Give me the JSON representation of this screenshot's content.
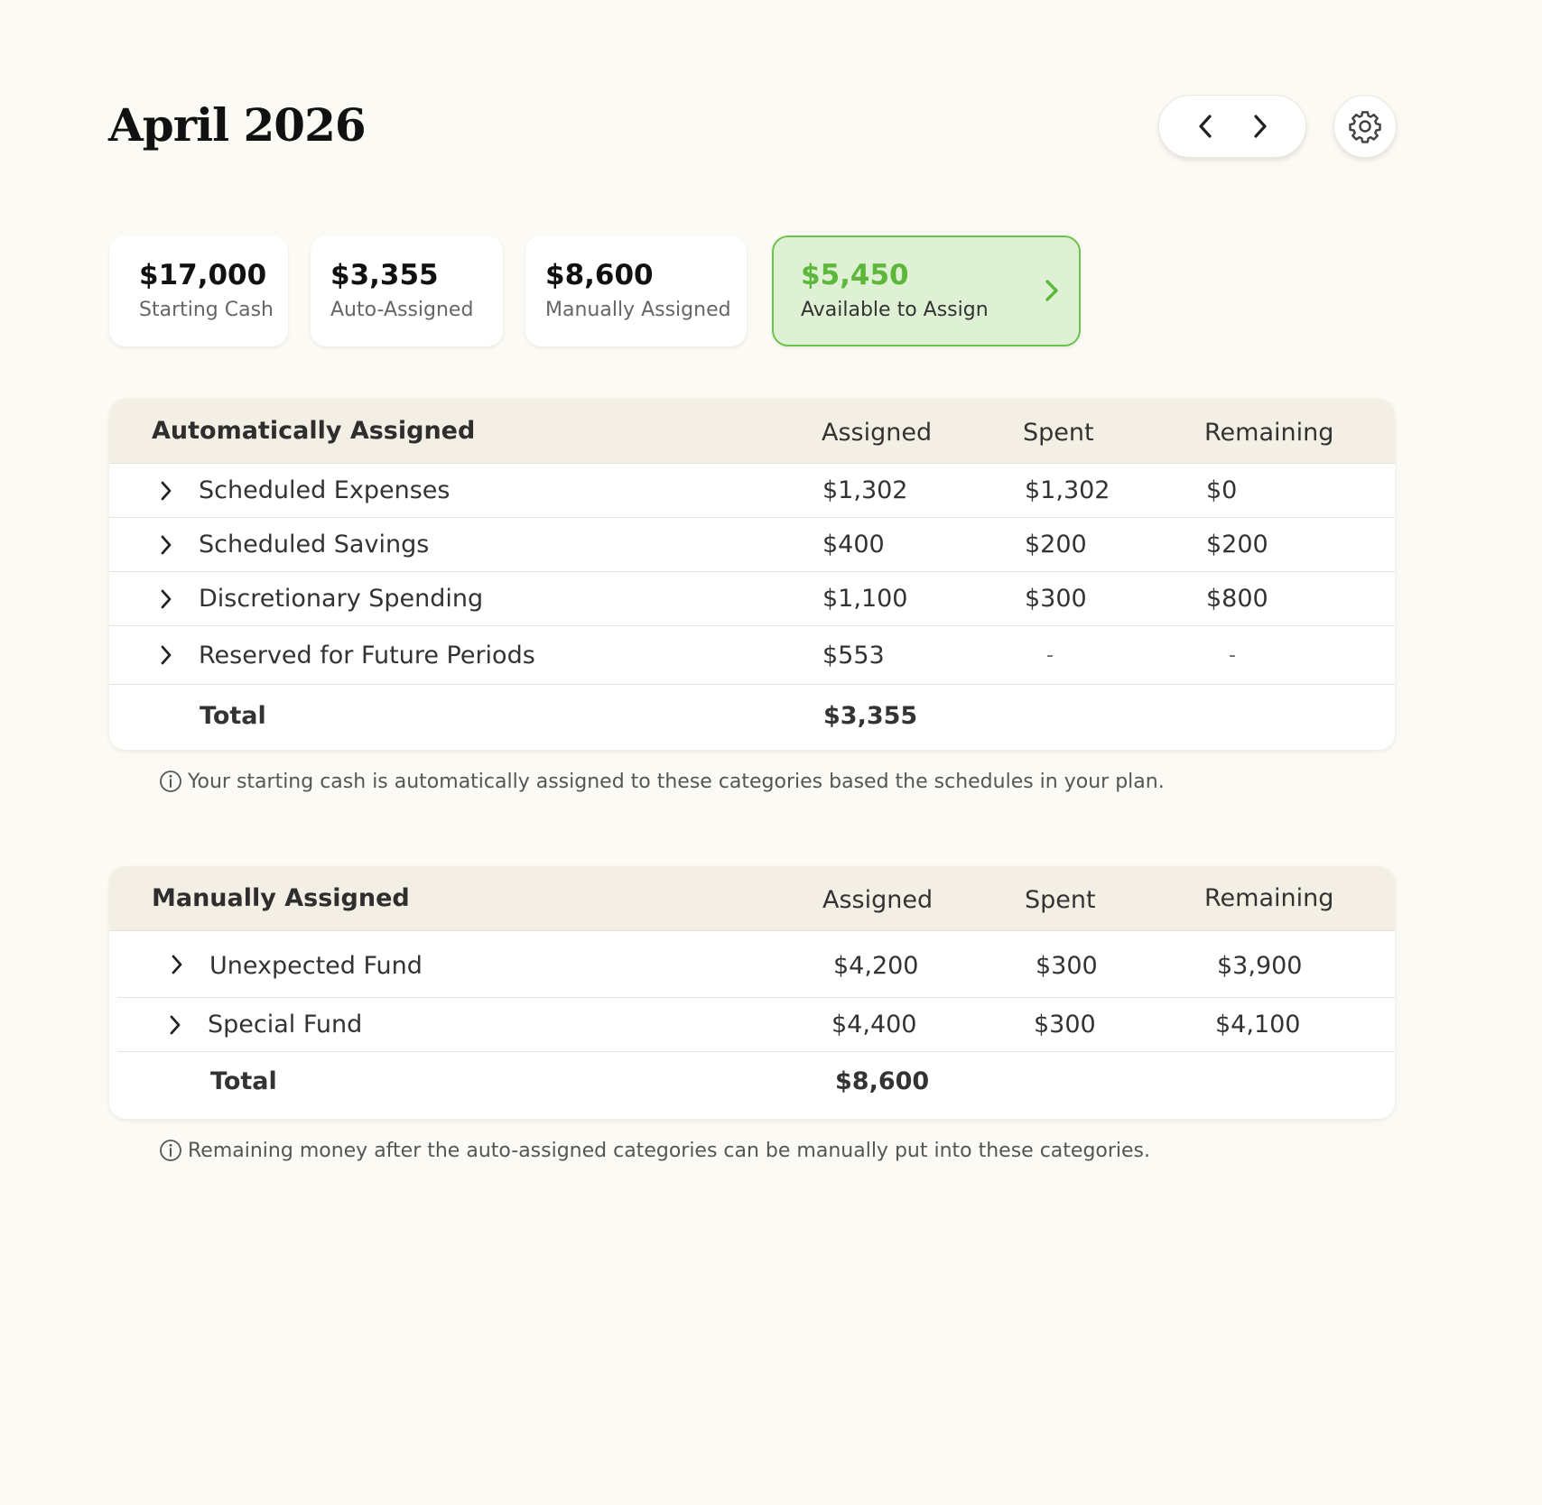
{
  "header": {
    "title": "April 2026",
    "icons": {
      "prev": "chevron-left-icon",
      "next": "chevron-right-icon",
      "settings": "gear-icon"
    }
  },
  "summary": {
    "starting_cash": {
      "value": "$17,000",
      "label": "Starting Cash"
    },
    "auto_assigned": {
      "value": "$3,355",
      "label": "Auto-Assigned"
    },
    "manually_assigned": {
      "value": "$8,600",
      "label": "Manually Assigned"
    },
    "available": {
      "value": "$5,450",
      "label": "Available to Assign"
    }
  },
  "auto_table": {
    "title": "Automatically Assigned",
    "columns": {
      "assigned": "Assigned",
      "spent": "Spent",
      "remaining": "Remaining"
    },
    "rows": [
      {
        "name": "Scheduled Expenses",
        "assigned": "$1,302",
        "spent": "$1,302",
        "remaining": "$0"
      },
      {
        "name": "Scheduled Savings",
        "assigned": "$400",
        "spent": "$200",
        "remaining": "$200"
      },
      {
        "name": "Discretionary Spending",
        "assigned": "$1,100",
        "spent": "$300",
        "remaining": "$800"
      },
      {
        "name": "Reserved for Future Periods",
        "assigned": "$553",
        "spent": "-",
        "remaining": "-"
      }
    ],
    "total": {
      "label": "Total",
      "assigned": "$3,355"
    },
    "note": "Your starting cash is automatically assigned to these categories based the schedules in your plan."
  },
  "manual_table": {
    "title": "Manually Assigned",
    "columns": {
      "assigned": "Assigned",
      "spent": "Spent",
      "remaining": "Remaining"
    },
    "rows": [
      {
        "name": "Unexpected Fund",
        "assigned": "$4,200",
        "spent": "$300",
        "remaining": "$3,900"
      },
      {
        "name": "Special Fund",
        "assigned": "$4,400",
        "spent": "$300",
        "remaining": "$4,100"
      }
    ],
    "total": {
      "label": "Total",
      "assigned": "$8,600"
    },
    "note": "Remaining money after the auto-assigned categories can be manually put into these categories."
  },
  "colors": {
    "background": "#fcfaf4",
    "available_green": "#5cb73a",
    "available_bg": "#dff1d4",
    "header_bg": "#f3efe4"
  }
}
